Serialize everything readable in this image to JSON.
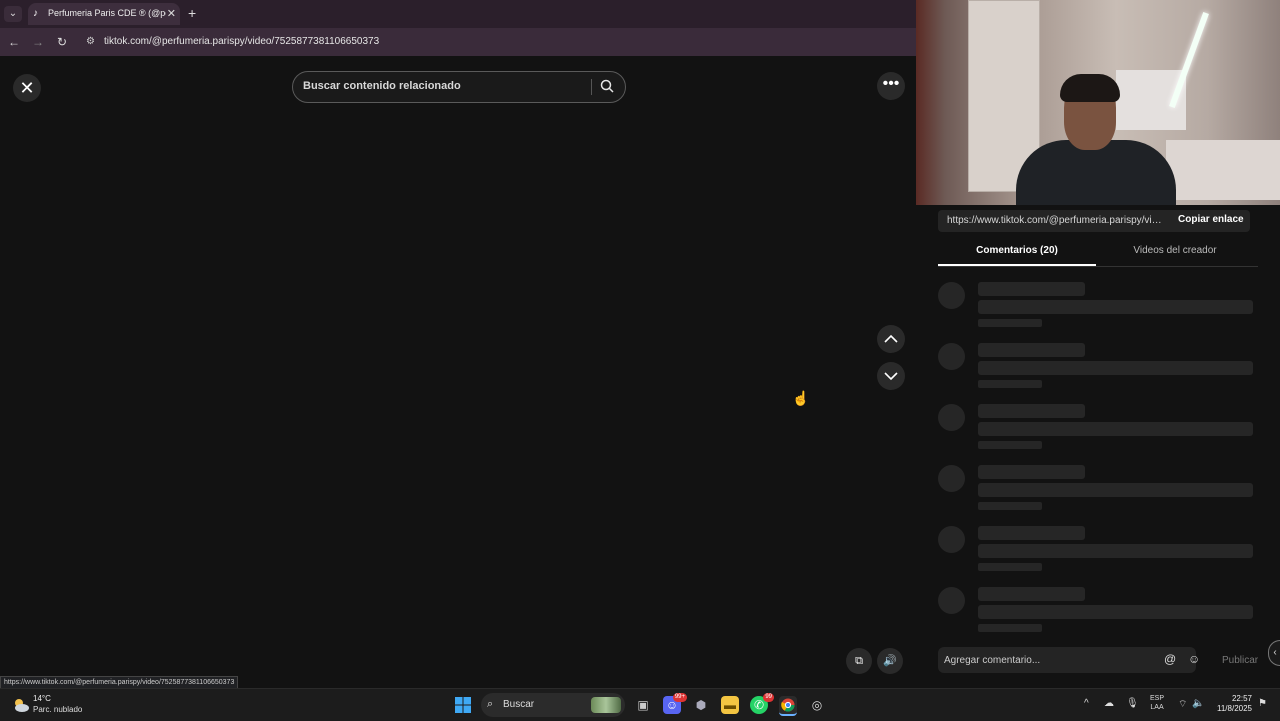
{
  "browser": {
    "tab_title": "Perfumeria Paris CDE ® (@perf",
    "tab_close": "✕",
    "new_tab": "+",
    "url": "tiktok.com/@perfumeria.parispy/video/7525877381106650373",
    "status_url": "https://www.tiktok.com/@perfumeria.parispy/video/7525877381106650373"
  },
  "player": {
    "search_placeholder": "Buscar contenido relacionado",
    "close_glyph": "✕",
    "more_glyph": "•••"
  },
  "side": {
    "share_link": "https://www.tiktok.com/@perfumeria.parispy/vid...",
    "copy_label": "Copiar enlace",
    "tab_comments": "Comentarios (20)",
    "tab_creator_videos": "Videos del creador",
    "comment_placeholder": "Agregar comentario...",
    "publish_label": "Publicar",
    "skeleton_count": 6
  },
  "taskbar": {
    "temperature": "14°C",
    "condition": "Parc. nublado",
    "search_label": "Buscar",
    "lang_top": "ESP",
    "lang_bottom": "LAA",
    "time": "22:57",
    "date": "11/8/2025",
    "badge_discord": "99+",
    "badge_whatsapp": "99"
  },
  "colors": {
    "background": "#121212",
    "tab_bar": "#2b1f2b",
    "nav_bar": "#3a2b3a",
    "skeleton": "#262626"
  },
  "icons": [
    "tiktok-icon",
    "search-icon",
    "close-icon",
    "more-icon",
    "chevron-up-icon",
    "chevron-down-icon",
    "pip-icon",
    "volume-icon",
    "mention-icon",
    "emoji-icon",
    "windows-icon",
    "weather-icon",
    "chrome-icon",
    "discord-icon",
    "whatsapp-icon",
    "folder-icon"
  ]
}
